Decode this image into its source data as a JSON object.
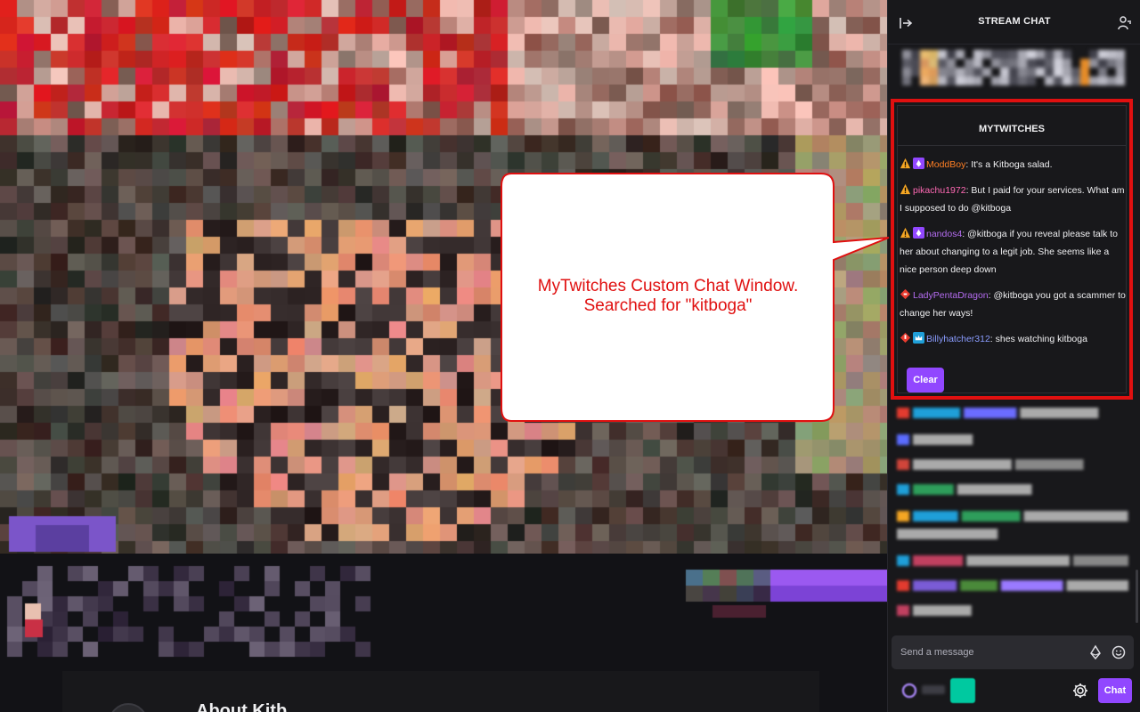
{
  "chat": {
    "header_title": "STREAM CHAT",
    "input_placeholder": "Send a message",
    "chat_button": "Chat"
  },
  "mytwitches": {
    "title": "MYTWITCHES",
    "clear_button": "Clear",
    "messages": [
      {
        "user": "ModdBoy",
        "color": "#ff7f24",
        "badges": [
          "warning",
          "bits-purple"
        ],
        "text": ": It's a Kitboga salad."
      },
      {
        "user": "pikachu1972",
        "color": "#ff69b4",
        "badges": [
          "warning"
        ],
        "text": ": But I paid for your services. What am I supposed to do @kitboga"
      },
      {
        "user": "nandos4",
        "color": "#b46cf0",
        "badges": [
          "warning",
          "bits-purple"
        ],
        "text": ": @kitboga if you reveal please talk to her about changing to a legit job. She seems like a nice person deep down"
      },
      {
        "user": "LadyPentaDragon",
        "color": "#b46cf0",
        "badges": [
          "red-diamond"
        ],
        "text": ": @kitboga you got a scammer to change her ways!"
      },
      {
        "user": "Billyhatcher312",
        "color": "#8a9cff",
        "badges": [
          "red-badge",
          "prime-crown"
        ],
        "text": ": shes watching kitboga"
      }
    ]
  },
  "callout": {
    "line1": "MyTwitches Custom Chat Window.",
    "line2": "Searched for \"kitboga\""
  },
  "about": {
    "title": "About Kitb"
  },
  "colors": {
    "accent": "#9147ff",
    "highlight_border": "#e01010"
  }
}
